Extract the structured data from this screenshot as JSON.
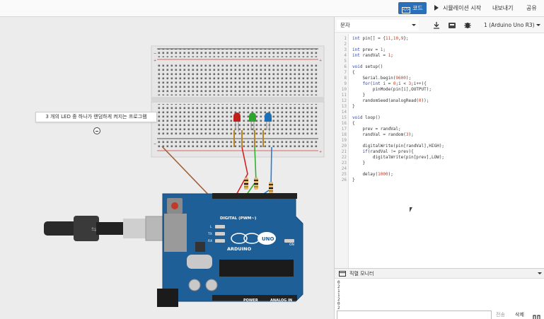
{
  "topbar": {
    "code_label": "코드",
    "simulate_label": "시뮬레이션 시작",
    "export_label": "내보내기",
    "share_label": "공유"
  },
  "canvas": {
    "tooltip": "3 개의 LED 중 하나가 랜덤하게 켜지는 프로그램"
  },
  "arduino": {
    "board_text": "ARDUINO",
    "uno_text": "UNO",
    "digital_label": "DIGITAL (PWM~)",
    "power_label": "POWER",
    "analog_label": "ANALOG IN",
    "on_label": "ON",
    "l_label": "L",
    "tx_label": "TX",
    "rx_label": "RX"
  },
  "leds": [
    {
      "color_name": "red",
      "color": "#c0201c"
    },
    {
      "color_name": "green",
      "color": "#2fa32c"
    },
    {
      "color_name": "blue",
      "color": "#1d6fb5"
    }
  ],
  "wire_colors": {
    "gnd": "#a0603a",
    "red": "#d42020",
    "green": "#33b033",
    "blue": "#2a7fd4"
  },
  "editor": {
    "mode": "문자",
    "device": "1 (Arduino Uno R3)",
    "lines": [
      {
        "n": "1",
        "text": "int pin[] = {11,10,9};"
      },
      {
        "n": "2",
        "text": ""
      },
      {
        "n": "3",
        "text": "int prev = 1;"
      },
      {
        "n": "4",
        "text": "int randVal = 1;"
      },
      {
        "n": "5",
        "text": ""
      },
      {
        "n": "6",
        "text": "void setup()"
      },
      {
        "n": "7",
        "text": "{"
      },
      {
        "n": "8",
        "text": "    Serial.begin(9600);"
      },
      {
        "n": "9",
        "text": "    for(int i = 0;i < 3;i++){"
      },
      {
        "n": "10",
        "text": "        pinMode(pin[i],OUTPUT);"
      },
      {
        "n": "11",
        "text": "    }"
      },
      {
        "n": "12",
        "text": "    randomSeed(analogRead(0));"
      },
      {
        "n": "13",
        "text": "}"
      },
      {
        "n": "14",
        "text": ""
      },
      {
        "n": "15",
        "text": "void loop()"
      },
      {
        "n": "16",
        "text": "{"
      },
      {
        "n": "17",
        "text": "    prev = randVal;"
      },
      {
        "n": "18",
        "text": "    randVal = random(3);"
      },
      {
        "n": "19",
        "text": ""
      },
      {
        "n": "20",
        "text": "    digitalWrite(pin[randVal],HIGH);"
      },
      {
        "n": "21",
        "text": "    if(randVal != prev){"
      },
      {
        "n": "22",
        "text": "        digitalWrite(pin[prev],LOW);"
      },
      {
        "n": "23",
        "text": "    }"
      },
      {
        "n": "24",
        "text": ""
      },
      {
        "n": "25",
        "text": "    delay(1000);"
      },
      {
        "n": "26",
        "text": "}"
      }
    ]
  },
  "serial": {
    "title": "직렬 모니터",
    "lines": [
      "0",
      "2",
      "1",
      "1",
      "2",
      "0",
      "2"
    ],
    "send_label": "전송",
    "clear_label": "삭제"
  }
}
